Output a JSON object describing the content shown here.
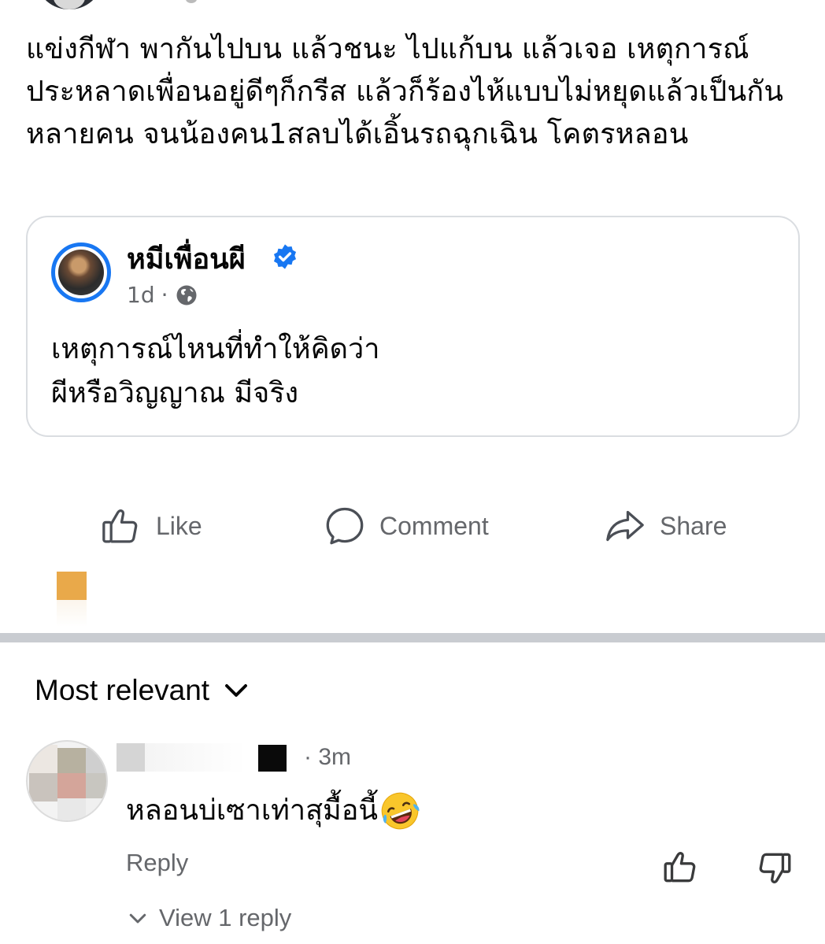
{
  "post": {
    "text": "แข่งกีฬา พากันไปบน แล้วชนะ ไปแก้บน แล้วเจอ เหตุการณ์ประหลาดเพื่อนอยู่ดีๆก็กรีส แล้วก็ร้องไห้แบบไม่หยุดแล้วเป็นกันหลายคน จนน้องคน1สลบได้เอิ้นรถฉุกเฉิน โคตรหลอน"
  },
  "shared": {
    "name": "หมีเพื่อนผี",
    "time": "1d",
    "separator": "·",
    "line1": "เหตุการณ์ไหนที่ทำให้คิดว่า",
    "line2": "ผีหรือวิญญาณ มีจริง",
    "verified_color": "#1877f2"
  },
  "actions": {
    "like": "Like",
    "comment": "Comment",
    "share": "Share"
  },
  "sort": {
    "label": "Most relevant"
  },
  "comment": {
    "time": "· 3m",
    "text": "หลอนบ่เซาเท่าสุมื้อนี้",
    "emoji": "laughing-emoji",
    "reply": "Reply",
    "view_replies": "View 1 reply"
  }
}
